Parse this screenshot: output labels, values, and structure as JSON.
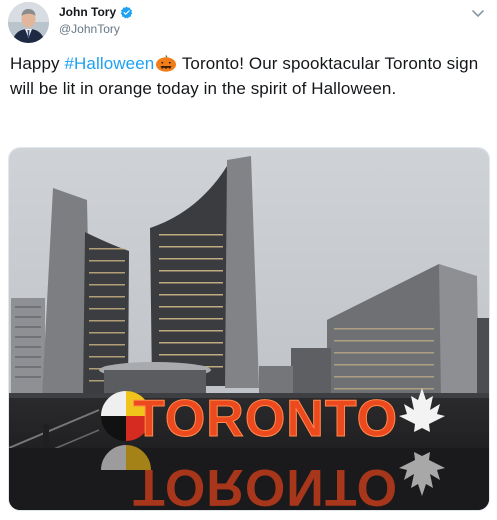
{
  "tweet": {
    "author_name": "John Tory",
    "author_handle": "@JohnTory",
    "verified": true,
    "text_before_hashtag": "Happy ",
    "hashtag": "#Halloween",
    "text_after_hashtag": " Toronto! Our spooktacular Toronto sign will be lit in orange today in the spirit of Halloween.",
    "emoji": "jack-o-lantern",
    "photo": {
      "sign_text": "TORONTO",
      "sign_color": "#e8401c",
      "subject": "Toronto City Hall towers behind the illuminated Toronto sign and its reflection"
    }
  },
  "colors": {
    "hashtag": "#1da1f2",
    "verified_badge": "#1da1f2",
    "handle": "#657786"
  }
}
